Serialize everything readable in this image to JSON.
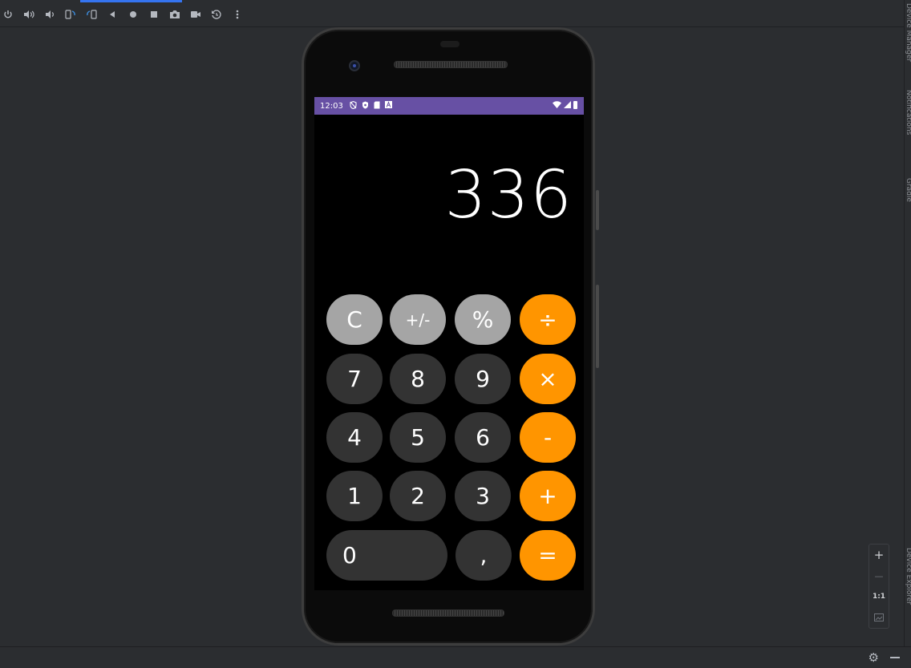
{
  "toolbar": {
    "icons": [
      "power-icon",
      "volume-up-icon",
      "volume-down-icon",
      "rotate-left-icon",
      "rotate-right-icon",
      "back-icon",
      "home-icon",
      "overview-icon",
      "screenshot-icon",
      "screen-record-icon",
      "reset-icon",
      "more-options-icon"
    ]
  },
  "right_stripe": {
    "labels": [
      "Device Manager",
      "Notifications",
      "Gradle",
      "Device Explorer"
    ]
  },
  "zoom_panel": {
    "zoom_in_label": "+",
    "zoom_out_label": "—",
    "actual_size_label": "1:1"
  },
  "device": {
    "status_bar": {
      "time": "12:03",
      "color": "#6750a4"
    },
    "calculator": {
      "display_value": "336",
      "keys": [
        {
          "label": "C",
          "style": "gray"
        },
        {
          "label": "+/-",
          "style": "gray"
        },
        {
          "label": "%",
          "style": "gray"
        },
        {
          "label": "÷",
          "style": "orange"
        },
        {
          "label": "7",
          "style": "dark"
        },
        {
          "label": "8",
          "style": "dark"
        },
        {
          "label": "9",
          "style": "dark"
        },
        {
          "label": "×",
          "style": "orange"
        },
        {
          "label": "4",
          "style": "dark"
        },
        {
          "label": "5",
          "style": "dark"
        },
        {
          "label": "6",
          "style": "dark"
        },
        {
          "label": "-",
          "style": "orange"
        },
        {
          "label": "1",
          "style": "dark"
        },
        {
          "label": "2",
          "style": "dark"
        },
        {
          "label": "3",
          "style": "dark"
        },
        {
          "label": "+",
          "style": "orange"
        },
        {
          "label": "0",
          "style": "dark"
        },
        {
          "label": ",",
          "style": "dark"
        },
        {
          "label": "=",
          "style": "orange"
        }
      ],
      "colors": {
        "orange": "#ff9500",
        "gray": "#a5a5a5",
        "dark": "#333333"
      }
    }
  }
}
